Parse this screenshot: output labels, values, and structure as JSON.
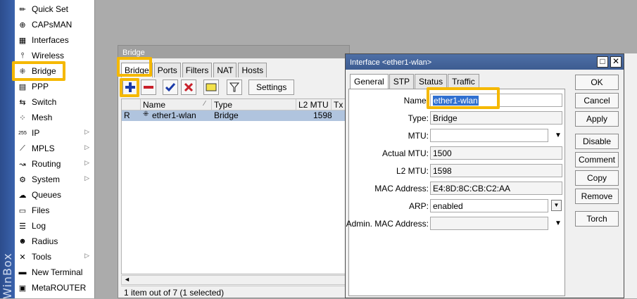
{
  "app": {
    "brand": "WinBox"
  },
  "menu": [
    {
      "label": "Quick Set",
      "icon": "quick-set-icon",
      "glyph": "✏"
    },
    {
      "label": "CAPsMAN",
      "icon": "capsman-icon",
      "glyph": "⊕"
    },
    {
      "label": "Interfaces",
      "icon": "interfaces-icon",
      "glyph": "▦"
    },
    {
      "label": "Wireless",
      "icon": "wireless-icon",
      "glyph": "⫯"
    },
    {
      "label": "Bridge",
      "icon": "bridge-icon",
      "glyph": "⁜"
    },
    {
      "label": "PPP",
      "icon": "ppp-icon",
      "glyph": "▤"
    },
    {
      "label": "Switch",
      "icon": "switch-icon",
      "glyph": "⇆"
    },
    {
      "label": "Mesh",
      "icon": "mesh-icon",
      "glyph": "⁘"
    },
    {
      "label": "IP",
      "icon": "ip-icon",
      "glyph": "255",
      "submenu": true
    },
    {
      "label": "MPLS",
      "icon": "mpls-icon",
      "glyph": "⟋",
      "submenu": true
    },
    {
      "label": "Routing",
      "icon": "routing-icon",
      "glyph": "↝",
      "submenu": true
    },
    {
      "label": "System",
      "icon": "system-icon",
      "glyph": "⚙",
      "submenu": true
    },
    {
      "label": "Queues",
      "icon": "queues-icon",
      "glyph": "☁"
    },
    {
      "label": "Files",
      "icon": "files-icon",
      "glyph": "▭"
    },
    {
      "label": "Log",
      "icon": "log-icon",
      "glyph": "☰"
    },
    {
      "label": "Radius",
      "icon": "radius-icon",
      "glyph": "☻"
    },
    {
      "label": "Tools",
      "icon": "tools-icon",
      "glyph": "✕",
      "submenu": true
    },
    {
      "label": "New Terminal",
      "icon": "terminal-icon",
      "glyph": "▬"
    },
    {
      "label": "MetaROUTER",
      "icon": "metarouter-icon",
      "glyph": "▣"
    }
  ],
  "bridge_window": {
    "title": "Bridge",
    "tabs": [
      "Bridge",
      "Ports",
      "Filters",
      "NAT",
      "Hosts"
    ],
    "settings_label": "Settings",
    "columns": [
      "Name",
      "Type",
      "L2 MTU",
      "Tx"
    ],
    "row": {
      "flag": "R",
      "name": "ether1-wlan",
      "name_prefix": "⁜",
      "type": "Bridge",
      "l2mtu": "1598"
    },
    "status": "1 item out of 7 (1 selected)"
  },
  "interface_dialog": {
    "title": "Interface <ether1-wlan>",
    "tabs": [
      "General",
      "STP",
      "Status",
      "Traffic"
    ],
    "fields": {
      "name": {
        "label": "Name:",
        "value": "ether1-wlan"
      },
      "type": {
        "label": "Type:",
        "value": "Bridge"
      },
      "mtu": {
        "label": "MTU:",
        "value": ""
      },
      "actual_mtu": {
        "label": "Actual MTU:",
        "value": "1500"
      },
      "l2_mtu": {
        "label": "L2 MTU:",
        "value": "1598"
      },
      "mac": {
        "label": "MAC Address:",
        "value": "E4:8D:8C:CB:C2:AA"
      },
      "arp": {
        "label": "ARP:",
        "value": "enabled"
      },
      "admin_mac": {
        "label": "Admin. MAC Address:",
        "value": ""
      }
    },
    "buttons": [
      "OK",
      "Cancel",
      "Apply",
      "Disable",
      "Comment",
      "Copy",
      "Remove",
      "Torch"
    ]
  },
  "colors": {
    "highlight": "#f5b800",
    "selection": "#3070d0",
    "title_bar": "#4e6fa6"
  }
}
